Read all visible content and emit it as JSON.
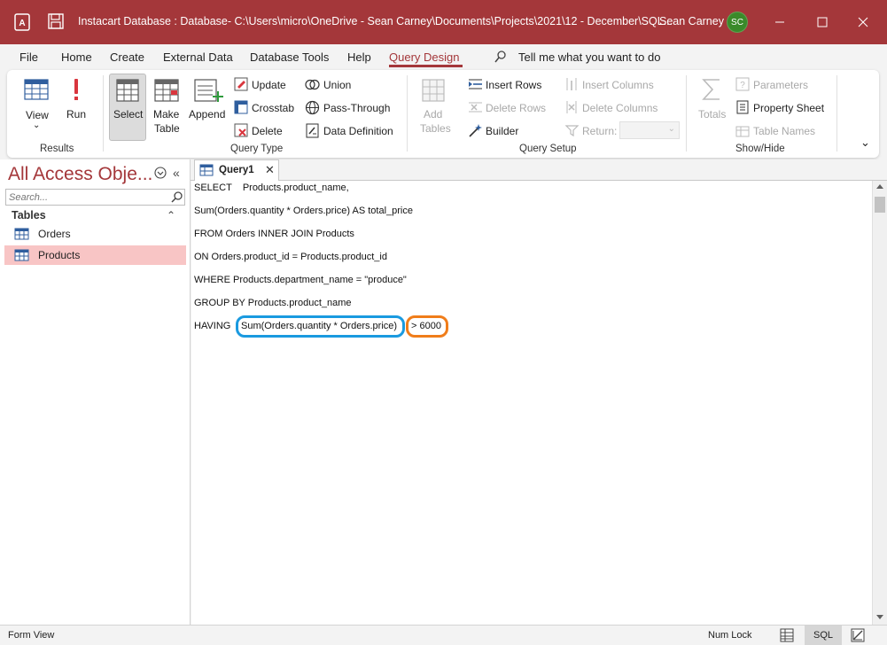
{
  "window": {
    "title": "Instacart Database : Database- C:\\Users\\micro\\OneDrive - Sean Carney\\Documents\\Projects\\2021\\12 - December\\SQL...",
    "user_name": "Sean Carney",
    "user_initials": "SC",
    "accent_color": "#a4373a"
  },
  "menu": {
    "items": [
      "File",
      "Home",
      "Create",
      "External Data",
      "Database Tools",
      "Help",
      "Query Design"
    ],
    "active": "Query Design",
    "tell_me": "Tell me what you want to do"
  },
  "ribbon": {
    "results": {
      "group_label": "Results",
      "view": "View",
      "run": "Run"
    },
    "query_type": {
      "group_label": "Query Type",
      "select": "Select",
      "make_table_1": "Make",
      "make_table_2": "Table",
      "append": "Append",
      "update": "Update",
      "crosstab": "Crosstab",
      "delete": "Delete",
      "union": "Union",
      "pass_through": "Pass-Through",
      "data_definition": "Data Definition"
    },
    "query_setup": {
      "group_label": "Query Setup",
      "add_tables_1": "Add",
      "add_tables_2": "Tables",
      "insert_rows": "Insert Rows",
      "delete_rows": "Delete Rows",
      "builder": "Builder",
      "insert_columns": "Insert Columns",
      "delete_columns": "Delete Columns",
      "return": "Return:"
    },
    "show_hide": {
      "group_label": "Show/Hide",
      "totals": "Totals",
      "parameters": "Parameters",
      "property_sheet": "Property Sheet",
      "table_names": "Table Names"
    }
  },
  "nav": {
    "title": "All Access Obje...",
    "search_placeholder": "Search...",
    "section": "Tables",
    "items": [
      {
        "label": "Orders",
        "selected": false
      },
      {
        "label": "Products",
        "selected": true
      }
    ]
  },
  "document": {
    "tab_label": "Query1",
    "sql_lines": [
      "SELECT    Products.product_name,",
      "Sum(Orders.quantity * Orders.price) AS total_price",
      "FROM Orders INNER JOIN Products",
      "ON Orders.product_id = Products.product_id",
      "WHERE Products.department_name = \"produce\"",
      "GROUP BY Products.product_name"
    ],
    "having_keyword": "HAVING",
    "having_expression": "Sum(Orders.quantity * Orders.price)",
    "having_condition": "> 6000",
    "highlight_blue": "#1a9ae0",
    "highlight_orange": "#f07d1a"
  },
  "status": {
    "left": "Form View",
    "num_lock": "Num Lock",
    "view_sql": "SQL"
  }
}
